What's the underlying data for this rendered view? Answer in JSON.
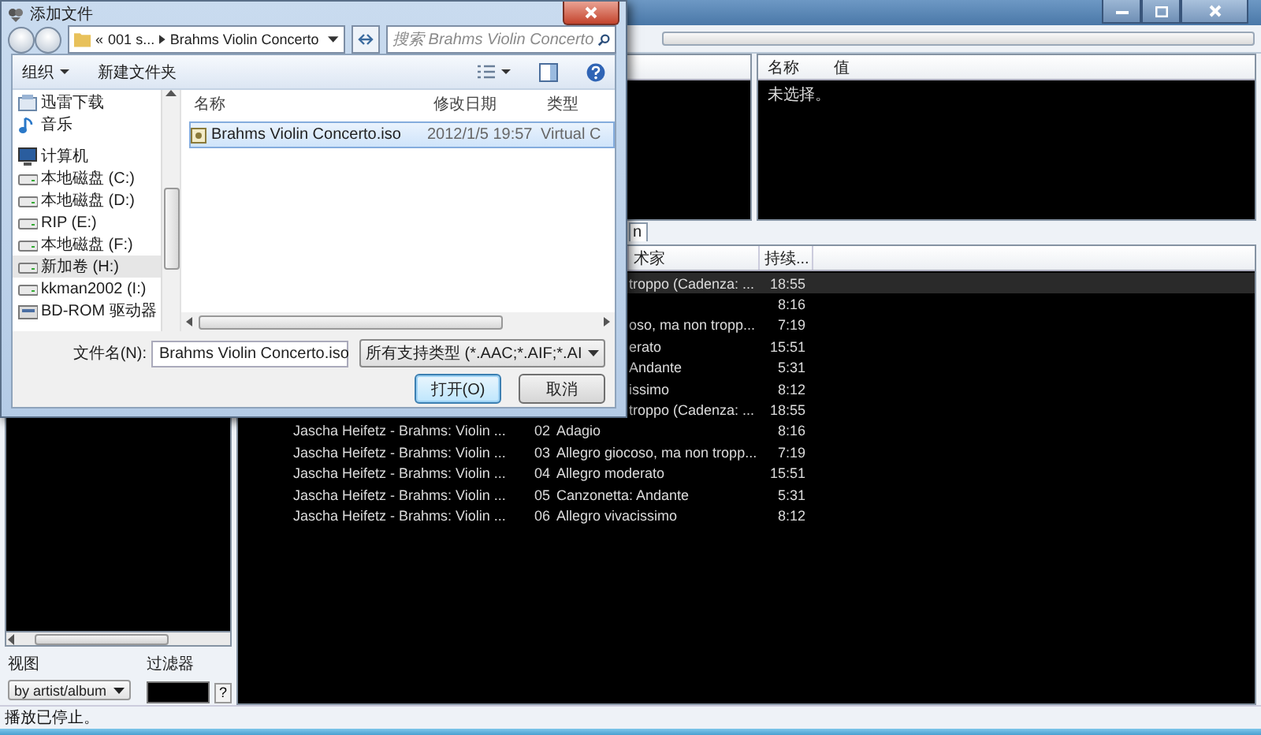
{
  "app_window": {
    "properties_panel": {
      "columns": [
        "名称",
        "值"
      ],
      "empty_text": "未选择。"
    },
    "tabs": [
      {
        "label": "n",
        "selected": true
      }
    ],
    "playlist": {
      "columns": [
        "术家",
        "持续..."
      ],
      "rows": [
        {
          "kind": "partial",
          "title": "troppo (Cadenza: ...",
          "duration": "18:55",
          "selected": true
        },
        {
          "kind": "partial",
          "title": "",
          "duration": "8:16",
          "selected": false
        },
        {
          "kind": "partial",
          "title": "oso, ma non tropp...",
          "duration": "7:19",
          "selected": false
        },
        {
          "kind": "partial",
          "title": "erato",
          "duration": "15:51",
          "selected": false
        },
        {
          "kind": "partial",
          "title": "Andante",
          "duration": "5:31",
          "selected": false
        },
        {
          "kind": "partial",
          "title": "issimo",
          "duration": "8:12",
          "selected": false
        },
        {
          "kind": "partial",
          "title": "troppo (Cadenza: ...",
          "duration": "18:55",
          "selected": false
        },
        {
          "kind": "full",
          "artist_album": "Jascha Heifetz - Brahms: Violin ...",
          "track": "02",
          "title": "Adagio",
          "duration": "8:16",
          "selected": false
        },
        {
          "kind": "full",
          "artist_album": "Jascha Heifetz - Brahms: Violin ...",
          "track": "03",
          "title": "Allegro giocoso, ma non tropp...",
          "duration": "7:19",
          "selected": false
        },
        {
          "kind": "full",
          "artist_album": "Jascha Heifetz - Brahms: Violin ...",
          "track": "04",
          "title": "Allegro moderato",
          "duration": "15:51",
          "selected": false
        },
        {
          "kind": "full",
          "artist_album": "Jascha Heifetz - Brahms: Violin ...",
          "track": "05",
          "title": "Canzonetta: Andante",
          "duration": "5:31",
          "selected": false
        },
        {
          "kind": "full",
          "artist_album": "Jascha Heifetz - Brahms: Violin ...",
          "track": "06",
          "title": "Allegro vivacissimo",
          "duration": "8:12",
          "selected": false
        }
      ]
    },
    "library": {
      "view_label": "视图",
      "view_value": "by artist/album",
      "filter_label": "过滤器",
      "help_button": "?"
    },
    "status_bar": "播放已停止。"
  },
  "dialog": {
    "title": "添加文件",
    "address": {
      "overflow": "«",
      "breadcrumbs": [
        "001 s...",
        "Brahms Violin Concerto"
      ]
    },
    "search": {
      "placeholder": "搜索 Brahms Violin Concerto"
    },
    "toolbar": {
      "organize": "组织",
      "new_folder": "新建文件夹"
    },
    "nav_items": [
      {
        "kind": "download",
        "label": "迅雷下载",
        "selected": false
      },
      {
        "kind": "music",
        "label": "音乐",
        "selected": false
      },
      {
        "kind": "computer",
        "label": "计算机",
        "selected": false
      },
      {
        "kind": "drive",
        "label": "本地磁盘 (C:)",
        "selected": false
      },
      {
        "kind": "drive",
        "label": "本地磁盘 (D:)",
        "selected": false
      },
      {
        "kind": "drive",
        "label": "RIP (E:)",
        "selected": false
      },
      {
        "kind": "drive",
        "label": "本地磁盘 (F:)",
        "selected": false
      },
      {
        "kind": "drive",
        "label": "新加卷 (H:)",
        "selected": true
      },
      {
        "kind": "drive",
        "label": "kkman2002 (I:)",
        "selected": false
      },
      {
        "kind": "cd",
        "label": "BD-ROM 驱动器",
        "selected": false
      }
    ],
    "file_columns": [
      "名称",
      "修改日期",
      "类型"
    ],
    "files": [
      {
        "name": "Brahms Violin Concerto.iso",
        "modified": "2012/1/5 19:57",
        "type": "Virtual C",
        "selected": true
      }
    ],
    "filename_label": "文件名(N):",
    "filename": "Brahms Violin Concerto.iso",
    "filetype": "所有支持类型 (*.AAC;*.AIF;*.AI",
    "buttons": [
      {
        "label": "打开(O)",
        "default": true
      },
      {
        "label": "取消",
        "default": false
      }
    ]
  }
}
